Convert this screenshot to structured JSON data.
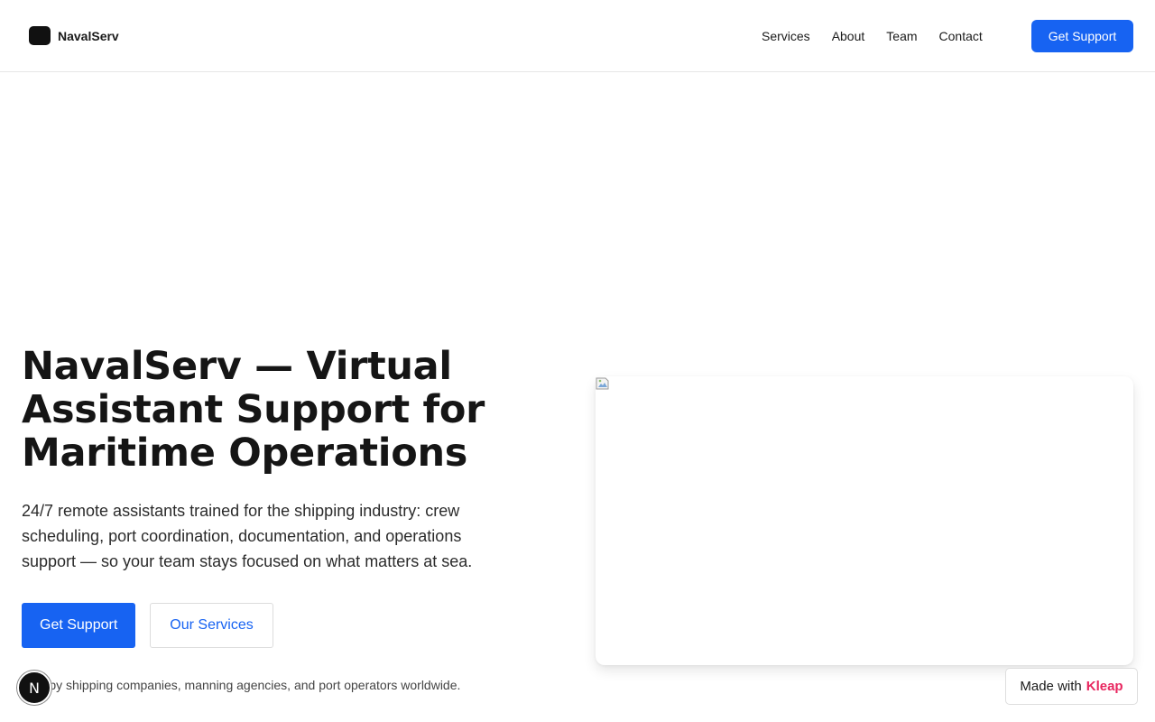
{
  "header": {
    "brand_name": "NavalServ",
    "nav": [
      "Services",
      "About",
      "Team",
      "Contact"
    ],
    "cta_label": "Get Support"
  },
  "hero": {
    "title": "NavalServ — Virtual Assistant Support for Maritime Operations",
    "description": "24/7 remote assistants trained for the shipping industry: crew scheduling, port coordination, documentation, and operations support — so your team stays focused on what matters at sea.",
    "primary_cta": "Get Support",
    "secondary_cta": "Our Services",
    "trusted_text": "sted by shipping companies, manning agencies, and port operators worldwide."
  },
  "overlays": {
    "avatar_letter": "N",
    "made_with_prefix": "Made with",
    "made_with_brand": "Kleap"
  },
  "colors": {
    "accent": "#1763f2",
    "badge_brand": "#e8265f"
  },
  "icons": [
    "logo-mark-icon",
    "broken-image-icon"
  ]
}
